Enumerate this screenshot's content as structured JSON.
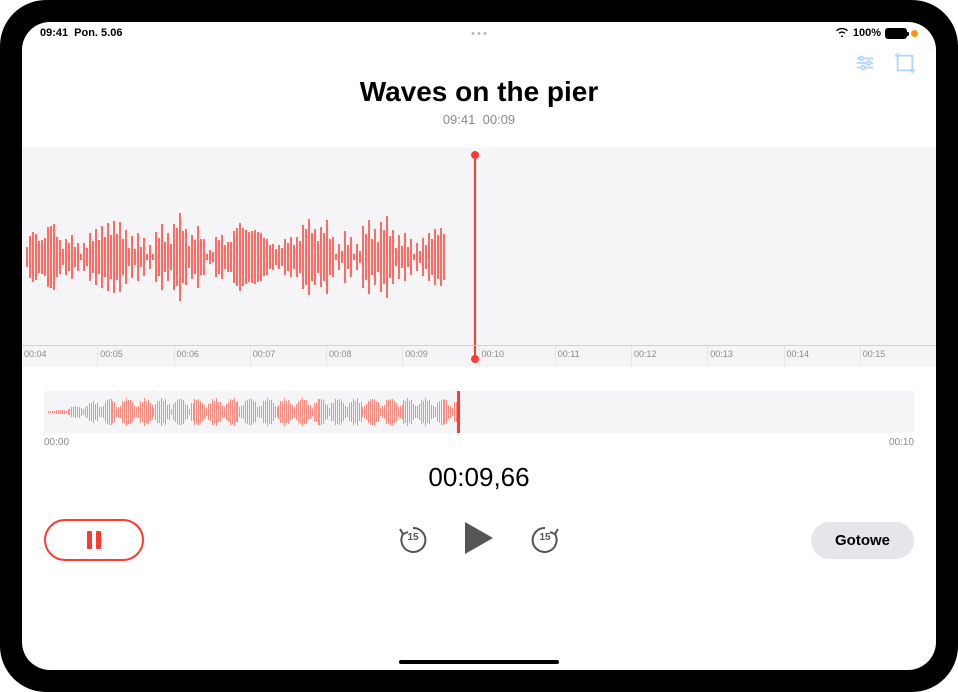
{
  "status": {
    "time": "09:41",
    "date": "Pon. 5.06",
    "battery_pct": "100%"
  },
  "recording": {
    "title": "Waves on the pier",
    "meta_time": "09:41",
    "meta_duration": "00:09"
  },
  "timeline": {
    "ticks": [
      "00:04",
      "00:05",
      "00:06",
      "00:07",
      "00:08",
      "00:09",
      "00:10",
      "00:11",
      "00:12",
      "00:13",
      "00:14",
      "00:15"
    ]
  },
  "overview": {
    "start": "00:00",
    "end": "00:10"
  },
  "playback": {
    "current_time": "00:09,66",
    "skip_seconds": "15"
  },
  "controls": {
    "done_label": "Gotowe"
  },
  "icons": {
    "settings": "sliders-icon",
    "crop": "crop-icon"
  },
  "colors": {
    "accent": "#ff3b30"
  }
}
